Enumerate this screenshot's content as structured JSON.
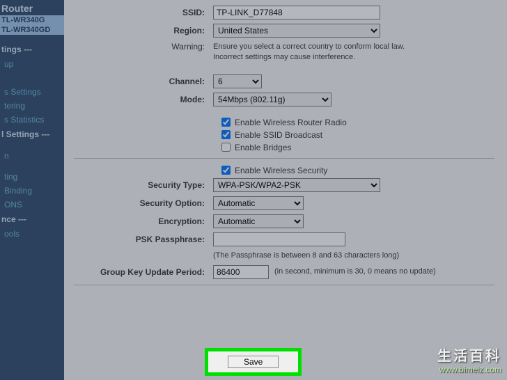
{
  "sidebar": {
    "brand": "Router",
    "models": [
      "TL-WR340G",
      "TL-WR340GD"
    ],
    "items": [
      {
        "label": "tings ---",
        "kind": "item"
      },
      {
        "label": "up",
        "kind": "sub"
      },
      {
        "label": "",
        "kind": "spacer"
      },
      {
        "label": "s Settings",
        "kind": "sub"
      },
      {
        "label": "tering",
        "kind": "sub"
      },
      {
        "label": "s Statistics",
        "kind": "sub"
      },
      {
        "label": "l Settings ---",
        "kind": "item"
      },
      {
        "label": "",
        "kind": "spacer"
      },
      {
        "label": "n",
        "kind": "sub"
      },
      {
        "label": "",
        "kind": "spacer"
      },
      {
        "label": "ting",
        "kind": "sub"
      },
      {
        "label": "Binding",
        "kind": "sub"
      },
      {
        "label": "ONS",
        "kind": "sub"
      },
      {
        "label": "nce ---",
        "kind": "item"
      },
      {
        "label": "ools",
        "kind": "sub"
      }
    ]
  },
  "form": {
    "ssid_label": "SSID:",
    "ssid_value": "TP-LINK_D77848",
    "region_label": "Region:",
    "region_value": "United States",
    "warning_label": "Warning:",
    "warning_text1": "Ensure you select a correct country to conform local law.",
    "warning_text2": "Incorrect settings may cause interference.",
    "channel_label": "Channel:",
    "channel_value": "6",
    "mode_label": "Mode:",
    "mode_value": "54Mbps (802.11g)",
    "cb_radio": "Enable Wireless Router Radio",
    "cb_broadcast": "Enable SSID Broadcast",
    "cb_bridges": "Enable Bridges",
    "cb_security": "Enable Wireless Security",
    "sectype_label": "Security Type:",
    "sectype_value": "WPA-PSK/WPA2-PSK",
    "secopt_label": "Security Option:",
    "secopt_value": "Automatic",
    "enc_label": "Encryption:",
    "enc_value": "Automatic",
    "psk_label": "PSK Passphrase:",
    "psk_value": "",
    "psk_note": "(The Passphrase is between 8 and 63 characters long)",
    "gkup_label": "Group Key Update Period:",
    "gkup_value": "86400",
    "gkup_note": "(in second, minimum is 30, 0 means no update)",
    "save_label": "Save"
  },
  "watermark": {
    "title": "生活百科",
    "url": "www.bimeiz.com"
  }
}
